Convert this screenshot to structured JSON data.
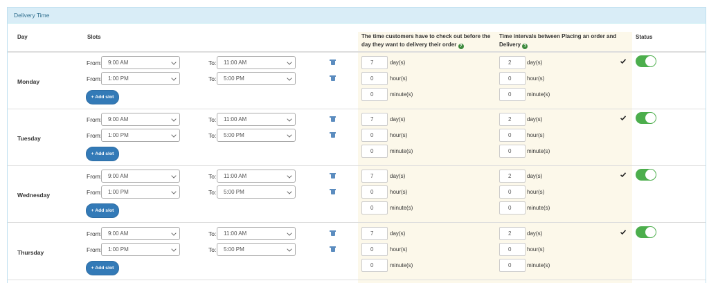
{
  "panel": {
    "title": "Delivery Time"
  },
  "headers": {
    "day": "Day",
    "slots": "Slots",
    "checkout_line1": "The time customers have to check out before the",
    "checkout_line2": "day they want to delivery their order",
    "interval_line1": "Time intervals between Placing an order and",
    "interval_line2": "Delivery",
    "status": "Status"
  },
  "labels": {
    "from": "From:",
    "to": "To:",
    "add_slot": "+ Add slot",
    "days": "day(s)",
    "hours": "hour(s)",
    "minutes": "minute(s)"
  },
  "icons": {
    "help": "question-circle-icon",
    "delete": "trash-icon",
    "saved": "checkmark-icon",
    "toggle": "toggle-switch"
  },
  "colors": {
    "panel_heading_bg": "#d9edf7",
    "highlight_column_bg": "#fcf8ea",
    "button_blue": "#337ab7",
    "toggle_green": "#4cae4c"
  },
  "rows": [
    {
      "day": "Monday",
      "slots": [
        {
          "from": "9:00 AM",
          "to": "11:00 AM"
        },
        {
          "from": "1:00 PM",
          "to": "5:00 PM"
        }
      ],
      "checkout": {
        "days": "7",
        "hours": "0",
        "minutes": "0"
      },
      "interval": {
        "days": "2",
        "hours": "0",
        "minutes": "0"
      },
      "status": "on"
    },
    {
      "day": "Tuesday",
      "slots": [
        {
          "from": "9:00 AM",
          "to": "11:00 AM"
        },
        {
          "from": "1:00 PM",
          "to": "5:00 PM"
        }
      ],
      "checkout": {
        "days": "7",
        "hours": "0",
        "minutes": "0"
      },
      "interval": {
        "days": "2",
        "hours": "0",
        "minutes": "0"
      },
      "status": "on"
    },
    {
      "day": "Wednesday",
      "slots": [
        {
          "from": "9:00 AM",
          "to": "11:00 AM"
        },
        {
          "from": "1:00 PM",
          "to": "5:00 PM"
        }
      ],
      "checkout": {
        "days": "7",
        "hours": "0",
        "minutes": "0"
      },
      "interval": {
        "days": "2",
        "hours": "0",
        "minutes": "0"
      },
      "status": "on"
    },
    {
      "day": "Thursday",
      "slots": [
        {
          "from": "9:00 AM",
          "to": "11:00 AM"
        },
        {
          "from": "1:00 PM",
          "to": "5:00 PM"
        }
      ],
      "checkout": {
        "days": "7",
        "hours": "0",
        "minutes": "0"
      },
      "interval": {
        "days": "2",
        "hours": "0",
        "minutes": "0"
      },
      "status": "on"
    }
  ]
}
